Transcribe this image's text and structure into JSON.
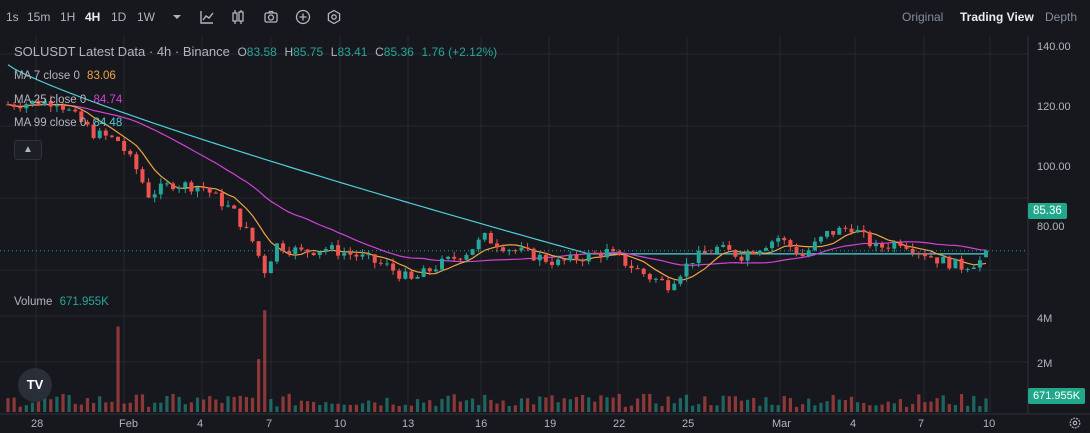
{
  "toolbar": {
    "timeframes": [
      {
        "label": "1s"
      },
      {
        "label": "15m"
      },
      {
        "label": "1H"
      },
      {
        "label": "4H"
      },
      {
        "label": "1D"
      },
      {
        "label": "1W"
      }
    ],
    "active_timeframe": "4H",
    "icons": [
      "chevron-down-icon",
      "indicators-icon",
      "candle-type-icon",
      "camera-icon",
      "add-icon",
      "settings-hex-icon"
    ],
    "views": [
      {
        "label": "Original"
      },
      {
        "label": "Trading View"
      },
      {
        "label": "Depth"
      }
    ],
    "active_view": "Trading View"
  },
  "legend": {
    "title": "SOLUSDT Latest Data · 4h · Binance",
    "o_label": "O",
    "o_value": "83.58",
    "h_label": "H",
    "h_value": "85.75",
    "l_label": "L",
    "l_value": "83.41",
    "c_label": "C",
    "c_value": "85.36",
    "change": "1.76 (+2.12%)"
  },
  "moving_averages": [
    {
      "label": "MA 7 close 0",
      "value": "83.06",
      "color": "#f0a446"
    },
    {
      "label": "MA 25 close 0",
      "value": "84.74",
      "color": "#d142d7"
    },
    {
      "label": "MA 99 close 0",
      "value": "84.48",
      "color": "#4ecfd9"
    }
  ],
  "volume": {
    "label": "Volume",
    "value": "671.955K"
  },
  "price_axis": [
    "140.00",
    "120.00",
    "100.00",
    "80.00"
  ],
  "volume_axis": [
    "4M",
    "2M"
  ],
  "current_price": "85.36",
  "current_volume": "671.955K",
  "time_axis": [
    "28",
    "Feb",
    "4",
    "7",
    "10",
    "13",
    "16",
    "19",
    "22",
    "25",
    "Mar",
    "4",
    "7",
    "10"
  ],
  "colors": {
    "up": "#26a69a",
    "down": "#ef5350",
    "background": "#16181d",
    "grid": "#262930"
  },
  "logo_text": "TV",
  "chart_data": {
    "type": "candlestick",
    "symbol": "SOLUSDT",
    "interval": "4h",
    "ylim": [
      75,
      145
    ],
    "anchors": [
      [
        0,
        126
      ],
      [
        8,
        127
      ],
      [
        14,
        118
      ],
      [
        18,
        116
      ],
      [
        21,
        108
      ],
      [
        23,
        101
      ],
      [
        27,
        104
      ],
      [
        32,
        103
      ],
      [
        37,
        96
      ],
      [
        40,
        88
      ],
      [
        42,
        80
      ],
      [
        44,
        87
      ],
      [
        48,
        85
      ],
      [
        52,
        86
      ],
      [
        57,
        84
      ],
      [
        62,
        81
      ],
      [
        66,
        77
      ],
      [
        70,
        81
      ],
      [
        75,
        85
      ],
      [
        78,
        89
      ],
      [
        82,
        86
      ],
      [
        86,
        84
      ],
      [
        90,
        82
      ],
      [
        95,
        84
      ],
      [
        98,
        85
      ],
      [
        100,
        83
      ],
      [
        105,
        78
      ],
      [
        108,
        76
      ],
      [
        112,
        83
      ],
      [
        116,
        86
      ],
      [
        120,
        84
      ],
      [
        126,
        89
      ],
      [
        130,
        84
      ],
      [
        134,
        90
      ],
      [
        138,
        92
      ],
      [
        142,
        86
      ],
      [
        146,
        88
      ],
      [
        152,
        83
      ],
      [
        156,
        81
      ],
      [
        160,
        83
      ]
    ],
    "volume_ylim": [
      0,
      5500000
    ],
    "volume_spikes": [
      [
        18,
        4200000
      ],
      [
        41,
        2600000
      ],
      [
        42,
        5000000
      ]
    ],
    "last": {
      "open": 83.58,
      "high": 85.75,
      "low": 83.41,
      "close": 85.36,
      "volume": 671955
    }
  }
}
